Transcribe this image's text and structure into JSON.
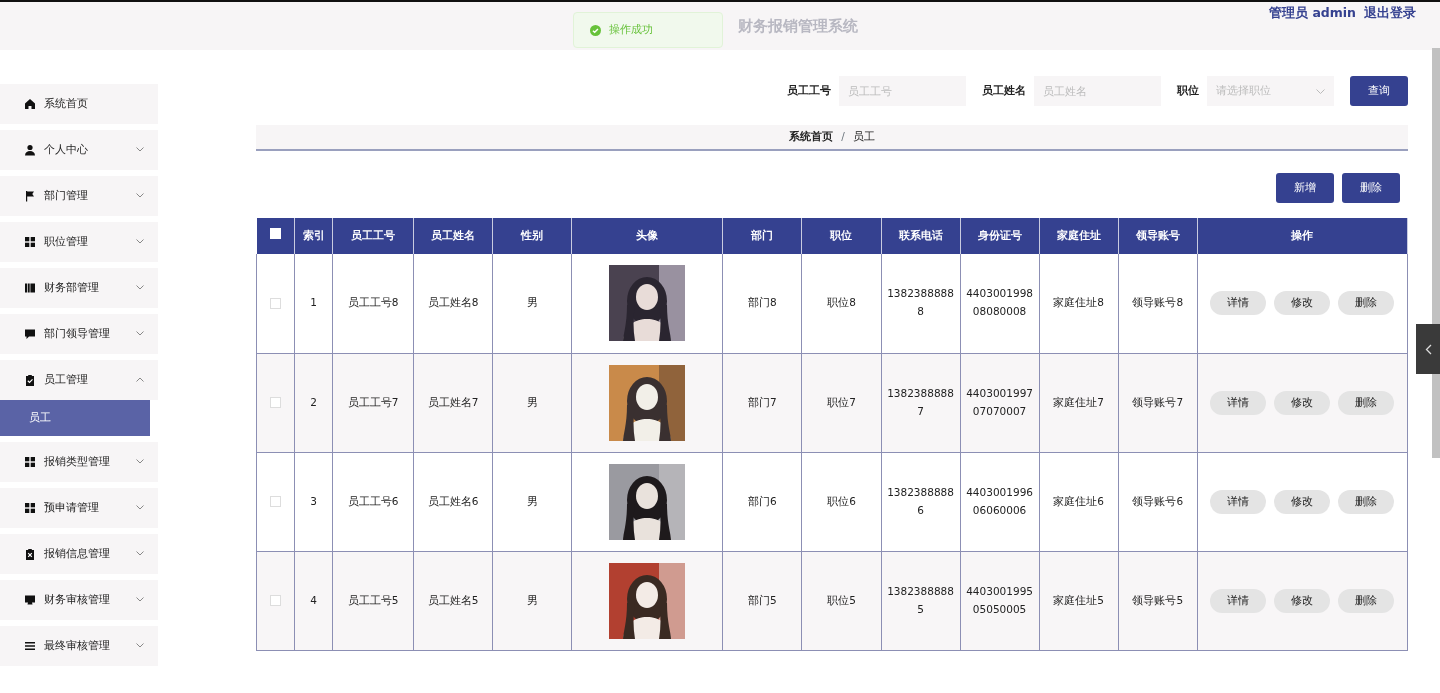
{
  "header": {
    "title": "财务报销管理系统",
    "user": "管理员 admin",
    "logout": "退出登录"
  },
  "toast": {
    "message": "操作成功"
  },
  "sidebar": {
    "items": [
      {
        "label": "系统首页",
        "kind": "link"
      },
      {
        "label": "个人中心",
        "kind": "group",
        "expanded": false
      },
      {
        "label": "部门管理",
        "kind": "group",
        "expanded": false
      },
      {
        "label": "职位管理",
        "kind": "group",
        "expanded": false
      },
      {
        "label": "财务部管理",
        "kind": "group",
        "expanded": false
      },
      {
        "label": "部门领导管理",
        "kind": "group",
        "expanded": false
      },
      {
        "label": "员工管理",
        "kind": "group",
        "expanded": true,
        "children": [
          {
            "label": "员工",
            "selected": true
          }
        ]
      },
      {
        "label": "报销类型管理",
        "kind": "group",
        "expanded": false
      },
      {
        "label": "预申请管理",
        "kind": "group",
        "expanded": false
      },
      {
        "label": "报销信息管理",
        "kind": "group",
        "expanded": false
      },
      {
        "label": "财务审核管理",
        "kind": "group",
        "expanded": false
      },
      {
        "label": "最终审核管理",
        "kind": "group",
        "expanded": false
      }
    ]
  },
  "search": {
    "fields": [
      {
        "label": "员工工号",
        "placeholder": "员工工号",
        "kind": "text"
      },
      {
        "label": "员工姓名",
        "placeholder": "员工姓名",
        "kind": "text"
      },
      {
        "label": "职位",
        "placeholder": "请选择职位",
        "kind": "select"
      }
    ],
    "button": "查询"
  },
  "breadcrumb": {
    "items": [
      "系统首页",
      "员工"
    ],
    "separator": "/"
  },
  "actions": [
    "新增",
    "删除"
  ],
  "table": {
    "header_checked": false,
    "columns": [
      "索引",
      "员工工号",
      "员工姓名",
      "性别",
      "头像",
      "部门",
      "职位",
      "联系电话",
      "身份证号",
      "家庭住址",
      "领导账号",
      "操作"
    ],
    "rows": [
      {
        "checked": false,
        "index": "1",
        "no": "员工工号8",
        "name": "员工姓名8",
        "gender": "男",
        "avatar": {
          "kind": "picture"
        },
        "dept": "部门8",
        "position": "职位8",
        "phone": "13823888888",
        "id_no": "440300199808080008",
        "address": "家庭住址8",
        "leader": "领导账号8",
        "actions": [
          "详情",
          "修改",
          "删除"
        ]
      },
      {
        "checked": false,
        "index": "2",
        "no": "员工工号7",
        "name": "员工姓名7",
        "gender": "男",
        "avatar": {
          "kind": "picture"
        },
        "dept": "部门7",
        "position": "职位7",
        "phone": "13823888887",
        "id_no": "440300199707070007",
        "address": "家庭住址7",
        "leader": "领导账号7",
        "actions": [
          "详情",
          "修改",
          "删除"
        ]
      },
      {
        "checked": false,
        "index": "3",
        "no": "员工工号6",
        "name": "员工姓名6",
        "gender": "男",
        "avatar": {
          "kind": "picture"
        },
        "dept": "部门6",
        "position": "职位6",
        "phone": "13823888886",
        "id_no": "440300199606060006",
        "address": "家庭住址6",
        "leader": "领导账号6",
        "actions": [
          "详情",
          "修改",
          "删除"
        ]
      },
      {
        "checked": false,
        "index": "4",
        "no": "员工工号5",
        "name": "员工姓名5",
        "gender": "男",
        "avatar": {
          "kind": "picture"
        },
        "dept": "部门5",
        "position": "职位5",
        "phone": "13823888885",
        "id_no": "440300199505050005",
        "address": "家庭住址5",
        "leader": "领导账号5",
        "actions": [
          "详情",
          "修改",
          "删除"
        ]
      }
    ]
  }
}
